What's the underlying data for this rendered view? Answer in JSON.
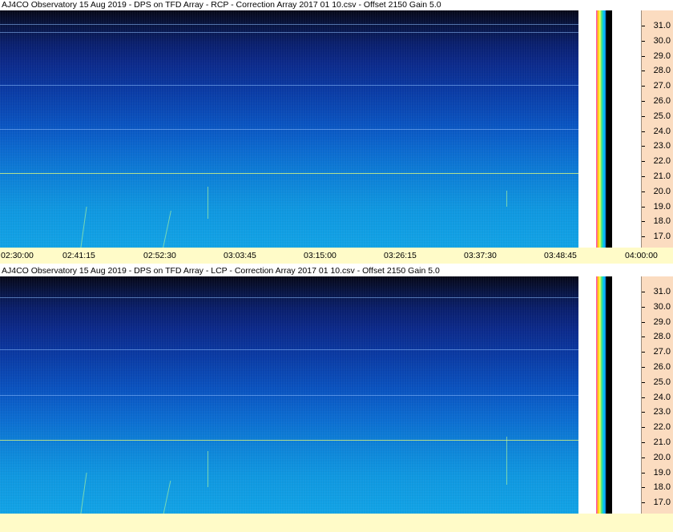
{
  "panels": [
    {
      "id": "rcp",
      "title": "AJ4CO Observatory 15 Aug 2019  -  DPS on TFD Array  -  RCP  -  Correction Array 2017 01 10.csv  -  Offset 2150  Gain 5.0",
      "freq_labels": [
        "31.0",
        "30.0",
        "29.0",
        "28.0",
        "27.0",
        "26.0",
        "25.0",
        "24.0",
        "23.0",
        "22.0",
        "21.0",
        "20.0",
        "19.0",
        "18.0",
        "17.0"
      ]
    },
    {
      "id": "lcp",
      "title": "AJ4CO Observatory 15 Aug 2019  -  DPS on TFD Array  -  LCP  -  Correction Array 2017 01 10.csv  -  Offset 2150  Gain 5.0",
      "freq_labels": [
        "31.0",
        "30.0",
        "29.0",
        "28.0",
        "27.0",
        "26.0",
        "25.0",
        "24.0",
        "23.0",
        "22.0",
        "21.0",
        "20.0",
        "19.0",
        "18.0",
        "17.0"
      ]
    }
  ],
  "time_axis": {
    "labels": [
      "02:30:00",
      "02:41:15",
      "02:52:30",
      "03:03:45",
      "03:15:00",
      "03:26:15",
      "03:37:30",
      "03:48:45",
      "04:00:00"
    ]
  },
  "colors": {
    "axis_bg": "#fbdcc0",
    "time_bg": "#fffbc8",
    "spectrogram_dark": "#060818",
    "spectrogram_light": "#12a6ea"
  }
}
